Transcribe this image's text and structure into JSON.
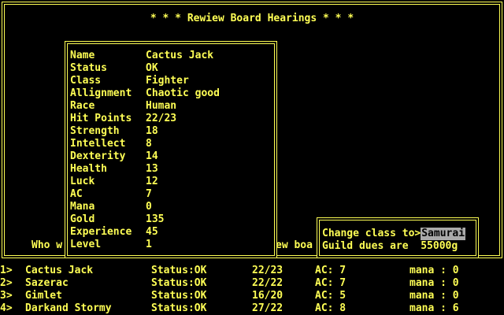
{
  "title": "* * * Rewiew Board Hearings * * *",
  "prompt_left": "Who w",
  "prompt_right": "ew boa",
  "sheet": [
    {
      "label": "Name",
      "value": "Cactus Jack"
    },
    {
      "label": "Status",
      "value": "OK"
    },
    {
      "label": "Class",
      "value": "Fighter"
    },
    {
      "label": "Allignment",
      "value": "Chaotic good"
    },
    {
      "label": "Race",
      "value": "Human"
    },
    {
      "label": "Hit Points",
      "value": "22/23"
    },
    {
      "label": "Strength",
      "value": "18"
    },
    {
      "label": "Intellect",
      "value": "8"
    },
    {
      "label": "Dexterity",
      "value": "14"
    },
    {
      "label": "Health",
      "value": "13"
    },
    {
      "label": "Luck",
      "value": "12"
    },
    {
      "label": "AC",
      "value": "7"
    },
    {
      "label": "Mana",
      "value": "0"
    },
    {
      "label": "Gold",
      "value": "135"
    },
    {
      "label": "Experience",
      "value": "45"
    },
    {
      "label": "Level",
      "value": "1"
    }
  ],
  "dialog": {
    "change_label": "Change class to>",
    "class_value": "Samurai",
    "dues_text": "Guild dues are  55000g"
  },
  "party": [
    {
      "num": "1>",
      "name": "Cactus Jack",
      "status": "Status:OK",
      "hp": "22/23",
      "ac": "AC: 7",
      "mana": "mana : 0"
    },
    {
      "num": "2>",
      "name": "Sazerac",
      "status": "Status:OK",
      "hp": "22/22",
      "ac": "AC: 7",
      "mana": "mana : 0"
    },
    {
      "num": "3>",
      "name": "Gimlet",
      "status": "Status:OK",
      "hp": "16/20",
      "ac": "AC: 5",
      "mana": "mana : 0"
    },
    {
      "num": "4>",
      "name": "Darkand Stormy",
      "status": "Status:OK",
      "hp": "27/22",
      "ac": "AC: 8",
      "mana": "mana : 6"
    }
  ],
  "colors": {
    "text": "#ffff55",
    "background": "#000000",
    "input_highlight": "#aaaaaa"
  }
}
